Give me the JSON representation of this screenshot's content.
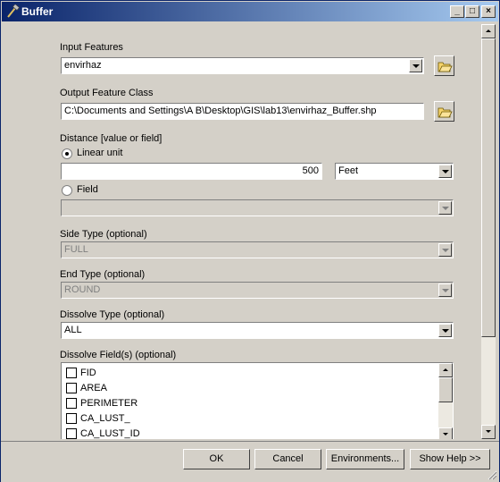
{
  "window": {
    "title": "Buffer"
  },
  "titlebar": {
    "minimize": "_",
    "maximize": "□",
    "close": "×"
  },
  "form": {
    "input_features": {
      "label": "Input Features",
      "value": "envirhaz"
    },
    "output_feature_class": {
      "label": "Output Feature Class",
      "value": "C:\\Documents and Settings\\A B\\Desktop\\GIS\\lab13\\envirhaz_Buffer.shp"
    },
    "distance": {
      "label": "Distance [value or field]",
      "linear_unit_label": "Linear unit",
      "linear_value": "500",
      "unit": "Feet",
      "field_label": "Field",
      "field_value": ""
    },
    "side_type": {
      "label": "Side Type (optional)",
      "value": "FULL"
    },
    "end_type": {
      "label": "End Type (optional)",
      "value": "ROUND"
    },
    "dissolve_type": {
      "label": "Dissolve Type (optional)",
      "value": "ALL"
    },
    "dissolve_fields": {
      "label": "Dissolve Field(s) (optional)",
      "items": [
        "FID",
        "AREA",
        "PERIMETER",
        "CA_LUST_",
        "CA_LUST_ID"
      ]
    }
  },
  "buttons": {
    "ok": "OK",
    "cancel": "Cancel",
    "environments": "Environments...",
    "show_help": "Show Help >>"
  }
}
